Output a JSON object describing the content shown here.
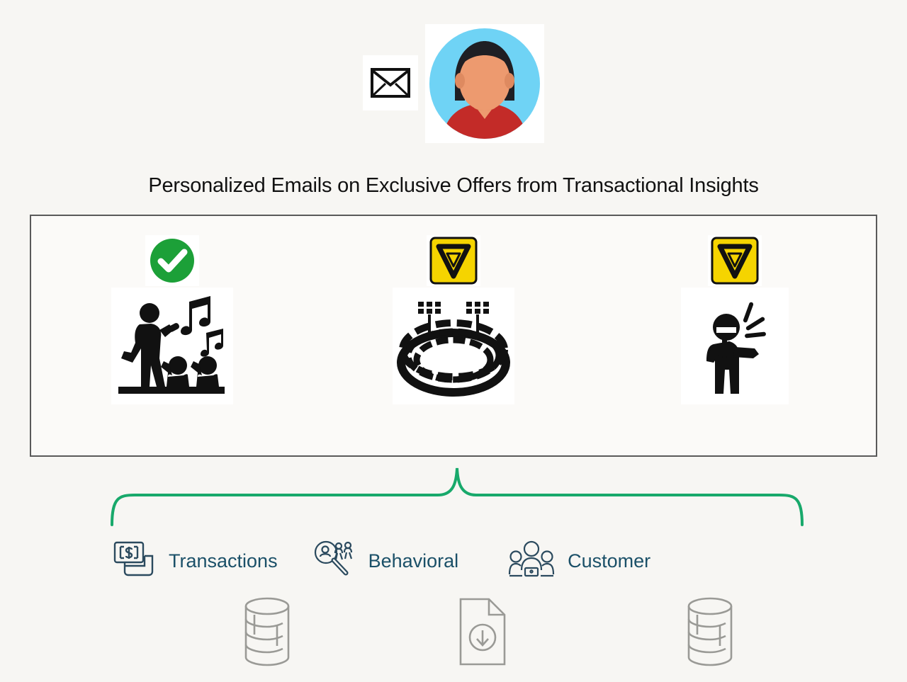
{
  "page": {
    "background_color": "#f7f6f3",
    "title": "Personalized Emails on Exclusive Offers from Transactional Insights"
  },
  "sender": {
    "mail_icon": "envelope-icon",
    "avatar_icon": "customer-avatar-icon",
    "avatar_colors": {
      "background": "#6fd3f5",
      "hair": "#1f1f24",
      "skin": "#ed9a6f",
      "shirt": "#c32b28"
    }
  },
  "panel": {
    "border_color": "#5a5a5a",
    "items": [
      {
        "status": "approved",
        "status_icon": "green-check-icon",
        "status_color": "#1ca038",
        "subject_icon": "concert-performance-icon",
        "subject_label": "Concert"
      },
      {
        "status": "warning",
        "status_icon": "yellow-yield-warning-icon",
        "status_color": "#f5d400",
        "subject_icon": "stadium-arena-icon",
        "subject_label": "Stadium"
      },
      {
        "status": "warning",
        "status_icon": "yellow-yield-warning-icon",
        "status_color": "#f5d400",
        "subject_icon": "speaker-announcement-icon",
        "subject_label": "Speaker"
      }
    ]
  },
  "connector": {
    "type": "curly-brace-up",
    "color": "#18a96b"
  },
  "sources": [
    {
      "label": "Transactions",
      "icon": "transaction-money-icon",
      "store_icon": "database-icon",
      "label_color": "#1b5068"
    },
    {
      "label": "Behavioral",
      "icon": "behavior-search-people-icon",
      "store_icon": "document-download-icon",
      "label_color": "#1b5068"
    },
    {
      "label": "Customer",
      "icon": "customer-group-icon",
      "store_icon": "database-icon",
      "label_color": "#1b5068"
    }
  ]
}
